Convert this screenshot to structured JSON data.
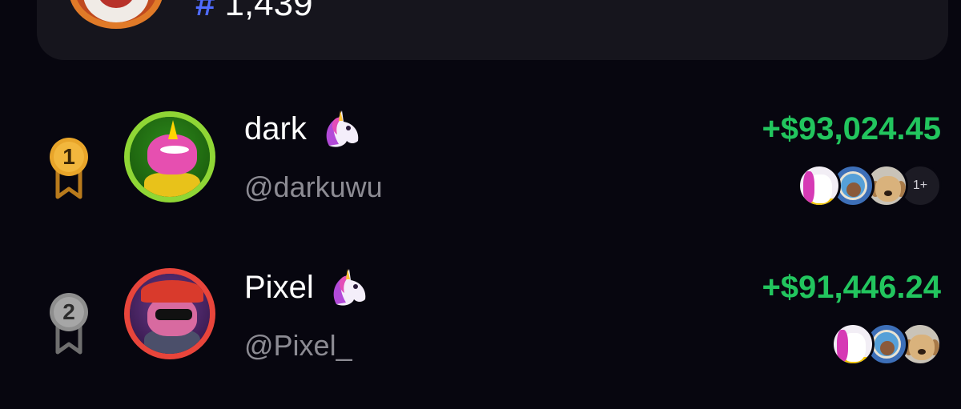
{
  "my_rank": {
    "hash_symbol": "#",
    "rank": "1,439"
  },
  "leaderboard": [
    {
      "position": "1",
      "medal": "gold-medal-icon",
      "display_name": "dark",
      "name_emoji": "unicorn-emoji-icon",
      "handle": "@darkuwu",
      "profit": "+$93,024.45",
      "holders": [
        "unicorn-avatar",
        "badge-avatar",
        "dog-avatar"
      ],
      "more_label": "1+"
    },
    {
      "position": "2",
      "medal": "silver-medal-icon",
      "display_name": "Pixel",
      "name_emoji": "unicorn-emoji-icon",
      "handle": "@Pixel_",
      "profit": "+$91,446.24",
      "holders": [
        "unicorn-avatar",
        "badge-avatar",
        "dog-avatar"
      ]
    }
  ],
  "colors": {
    "background": "#07060f",
    "card": "#16151d",
    "profit_green": "#22c55e",
    "hash_blue": "#4f6bff",
    "gold": "#e8a52a",
    "silver": "#9a9a9a"
  }
}
